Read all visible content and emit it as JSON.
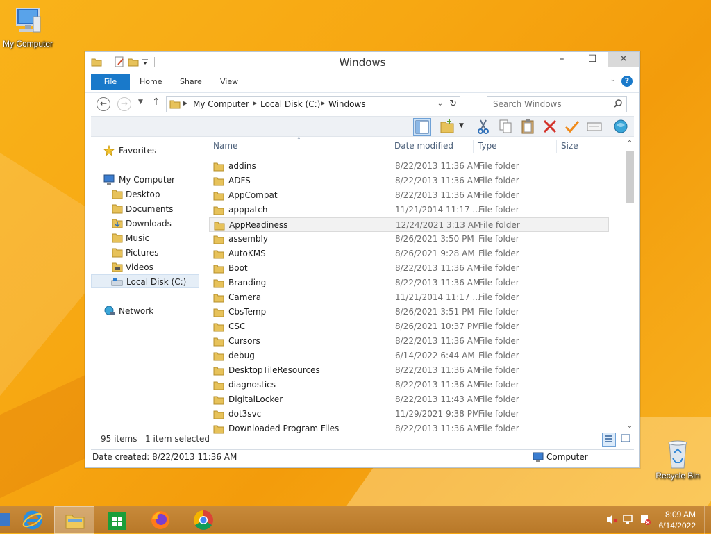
{
  "desktop": {
    "icons": [
      {
        "label": "My Computer",
        "icon": "computer-icon"
      },
      {
        "label": "Recycle Bin",
        "icon": "recycle-bin-icon"
      }
    ]
  },
  "window": {
    "title": "Windows",
    "quick_access": [
      "folder-icon",
      "properties-icon",
      "new-folder-icon",
      "dropdown-icon"
    ],
    "controls": {
      "minimize": "–",
      "maximize": "☐",
      "close": "✕"
    }
  },
  "ribbon": {
    "tabs": [
      "File",
      "Home",
      "Share",
      "View"
    ],
    "help": "?"
  },
  "address": {
    "crumbs": [
      "My Computer",
      "Local Disk (C:)",
      "Windows"
    ],
    "search_placeholder": "Search Windows"
  },
  "toolbar": {
    "buttons": [
      "navigation-pane-icon",
      "new-folder-icon",
      "cut-icon",
      "copy-icon",
      "paste-icon",
      "delete-icon",
      "rename-icon",
      "properties-icon",
      "open-icon"
    ]
  },
  "nav_pane": {
    "favorites": "Favorites",
    "computer": "My Computer",
    "children": [
      "Desktop",
      "Documents",
      "Downloads",
      "Music",
      "Pictures",
      "Videos",
      "Local Disk (C:)"
    ],
    "network": "Network",
    "selected": "Local Disk (C:)"
  },
  "columns": {
    "name": "Name",
    "date": "Date modified",
    "type": "Type",
    "size": "Size"
  },
  "files": [
    {
      "name": "addins",
      "date": "8/22/2013 11:36 AM",
      "type": "File folder"
    },
    {
      "name": "ADFS",
      "date": "8/22/2013 11:36 AM",
      "type": "File folder"
    },
    {
      "name": "AppCompat",
      "date": "8/22/2013 11:36 AM",
      "type": "File folder"
    },
    {
      "name": "apppatch",
      "date": "11/21/2014 11:17 ...",
      "type": "File folder"
    },
    {
      "name": "AppReadiness",
      "date": "12/24/2021 3:13 AM",
      "type": "File folder"
    },
    {
      "name": "assembly",
      "date": "8/26/2021 3:50 PM",
      "type": "File folder"
    },
    {
      "name": "AutoKMS",
      "date": "8/26/2021 9:28 AM",
      "type": "File folder"
    },
    {
      "name": "Boot",
      "date": "8/22/2013 11:36 AM",
      "type": "File folder"
    },
    {
      "name": "Branding",
      "date": "8/22/2013 11:36 AM",
      "type": "File folder"
    },
    {
      "name": "Camera",
      "date": "11/21/2014 11:17 ...",
      "type": "File folder"
    },
    {
      "name": "CbsTemp",
      "date": "8/26/2021 3:51 PM",
      "type": "File folder"
    },
    {
      "name": "CSC",
      "date": "8/26/2021 10:37 PM",
      "type": "File folder"
    },
    {
      "name": "Cursors",
      "date": "8/22/2013 11:36 AM",
      "type": "File folder"
    },
    {
      "name": "debug",
      "date": "6/14/2022 6:44 AM",
      "type": "File folder"
    },
    {
      "name": "DesktopTileResources",
      "date": "8/22/2013 11:36 AM",
      "type": "File folder"
    },
    {
      "name": "diagnostics",
      "date": "8/22/2013 11:36 AM",
      "type": "File folder"
    },
    {
      "name": "DigitalLocker",
      "date": "8/22/2013 11:43 AM",
      "type": "File folder"
    },
    {
      "name": "dot3svc",
      "date": "11/29/2021 9:38 PM",
      "type": "File folder"
    },
    {
      "name": "Downloaded Program Files",
      "date": "8/22/2013 11:36 AM",
      "type": "File folder"
    }
  ],
  "hovered_row": "AppReadiness",
  "status": {
    "items": "95 items",
    "selected": "1 item selected"
  },
  "details": {
    "created": "Date created: 8/22/2013 11:36 AM",
    "location": "Computer"
  },
  "taskbar": {
    "apps": [
      "internet-explorer-icon",
      "file-explorer-icon",
      "store-icon",
      "firefox-icon",
      "chrome-icon"
    ],
    "active_app": "file-explorer-icon",
    "tray": [
      "volume-muted-icon",
      "network-icon",
      "action-center-icon"
    ],
    "time": "8:09 AM",
    "date": "6/14/2022"
  },
  "colors": {
    "accent": "#1979ca",
    "desktop": "#f7a712",
    "taskbar": "#c08030"
  }
}
